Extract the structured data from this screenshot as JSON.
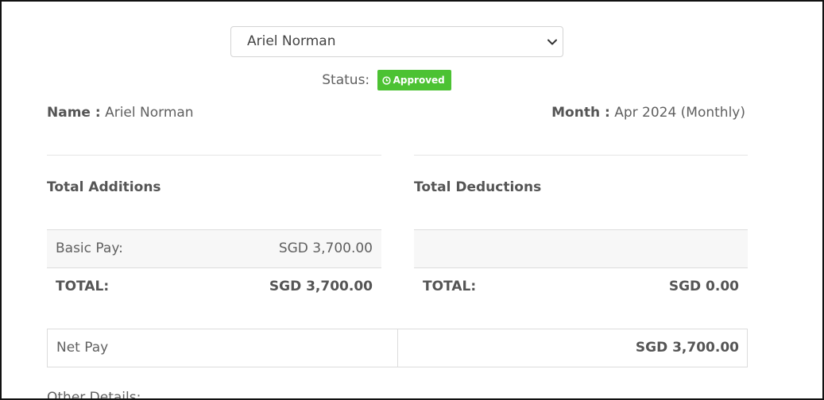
{
  "employee_select": {
    "value": "Ariel Norman",
    "icon": "chevron-down-icon"
  },
  "status": {
    "label": "Status:",
    "badge": "Approved",
    "badge_color": "#4cc233",
    "icon": "clock-icon"
  },
  "employee": {
    "name_label": "Name :",
    "name": "Ariel Norman",
    "month_label": "Month :",
    "month": "Apr 2024 (Monthly)"
  },
  "additions": {
    "title": "Total Additions",
    "rows": [
      {
        "label": "Basic Pay:",
        "value": "SGD 3,700.00"
      }
    ],
    "total_label": "TOTAL:",
    "total_value": "SGD 3,700.00"
  },
  "deductions": {
    "title": "Total Deductions",
    "total_label": "TOTAL:",
    "total_value": "SGD 0.00"
  },
  "net_pay": {
    "label": "Net Pay",
    "value": "SGD 3,700.00"
  },
  "other_details": {
    "label": "Other Details:"
  }
}
